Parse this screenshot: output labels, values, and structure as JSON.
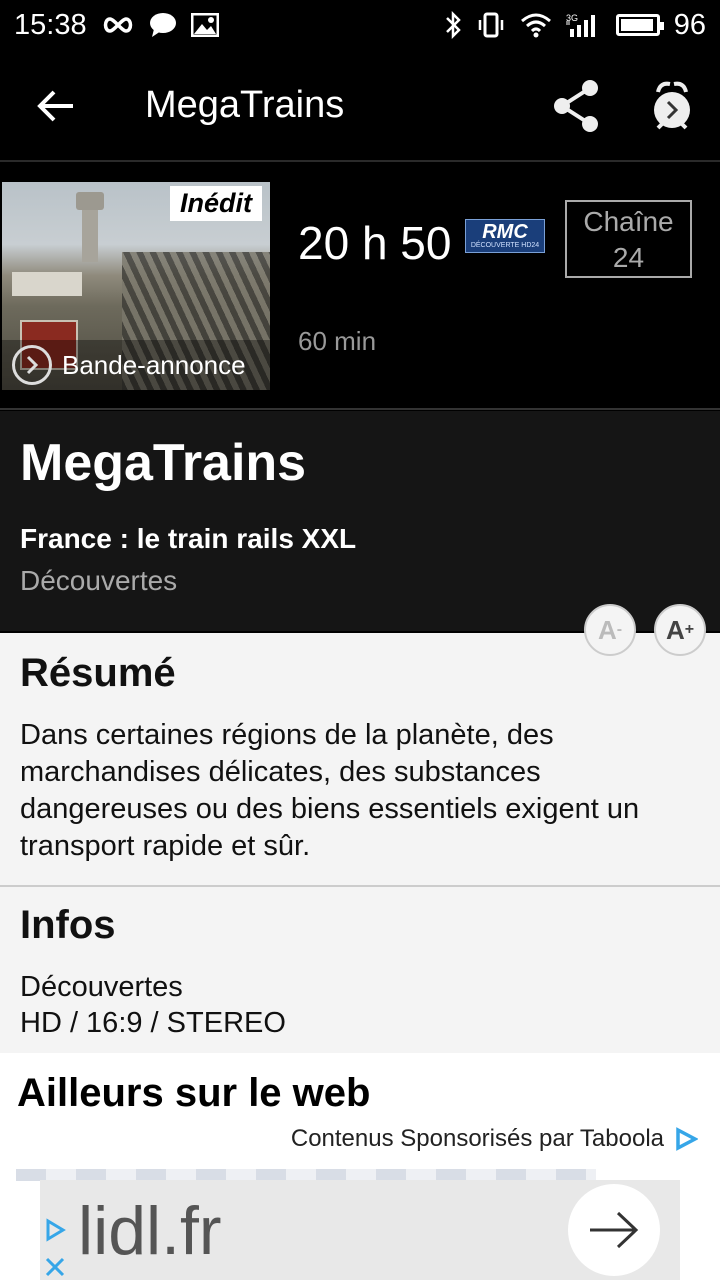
{
  "status_bar": {
    "time": "15:38",
    "battery": "96",
    "battery_level": 0.96
  },
  "app_bar": {
    "title": "MegaTrains",
    "icons": [
      "back-arrow-icon",
      "share-icon",
      "alarm-clock-icon"
    ]
  },
  "program": {
    "badge": "Inédit",
    "trailer_label": "Bande-annonce",
    "time": "20 h 50",
    "channel_logo": {
      "main": "RMC",
      "sub": "DÉCOUVERTE HD24"
    },
    "channel_label": "Chaîne",
    "channel_number": "24",
    "duration": "60 min"
  },
  "details": {
    "title": "MegaTrains",
    "episode": "France : le train rails XXL",
    "genre": "Découvertes"
  },
  "font_controls": {
    "decrease": "A",
    "increase": "A"
  },
  "resume": {
    "heading": "Résumé",
    "text": "Dans certaines régions de la planète, des marchandises délicates, des substances dangereuses ou des biens essentiels exigent un transport rapide et sûr."
  },
  "infos": {
    "heading": "Infos",
    "genre": "Découvertes",
    "format": "HD / 16:9 / STEREO"
  },
  "web": {
    "heading": "Ailleurs sur le web",
    "sponsor": "Contenus Sponsorisés par Taboola"
  },
  "ad": {
    "domain": "lidl.fr"
  },
  "colors": {
    "background_dark": "#000000",
    "panel_dark": "#151515",
    "content_light": "#f4f4f4",
    "taboola_blue": "#36a6e8"
  }
}
